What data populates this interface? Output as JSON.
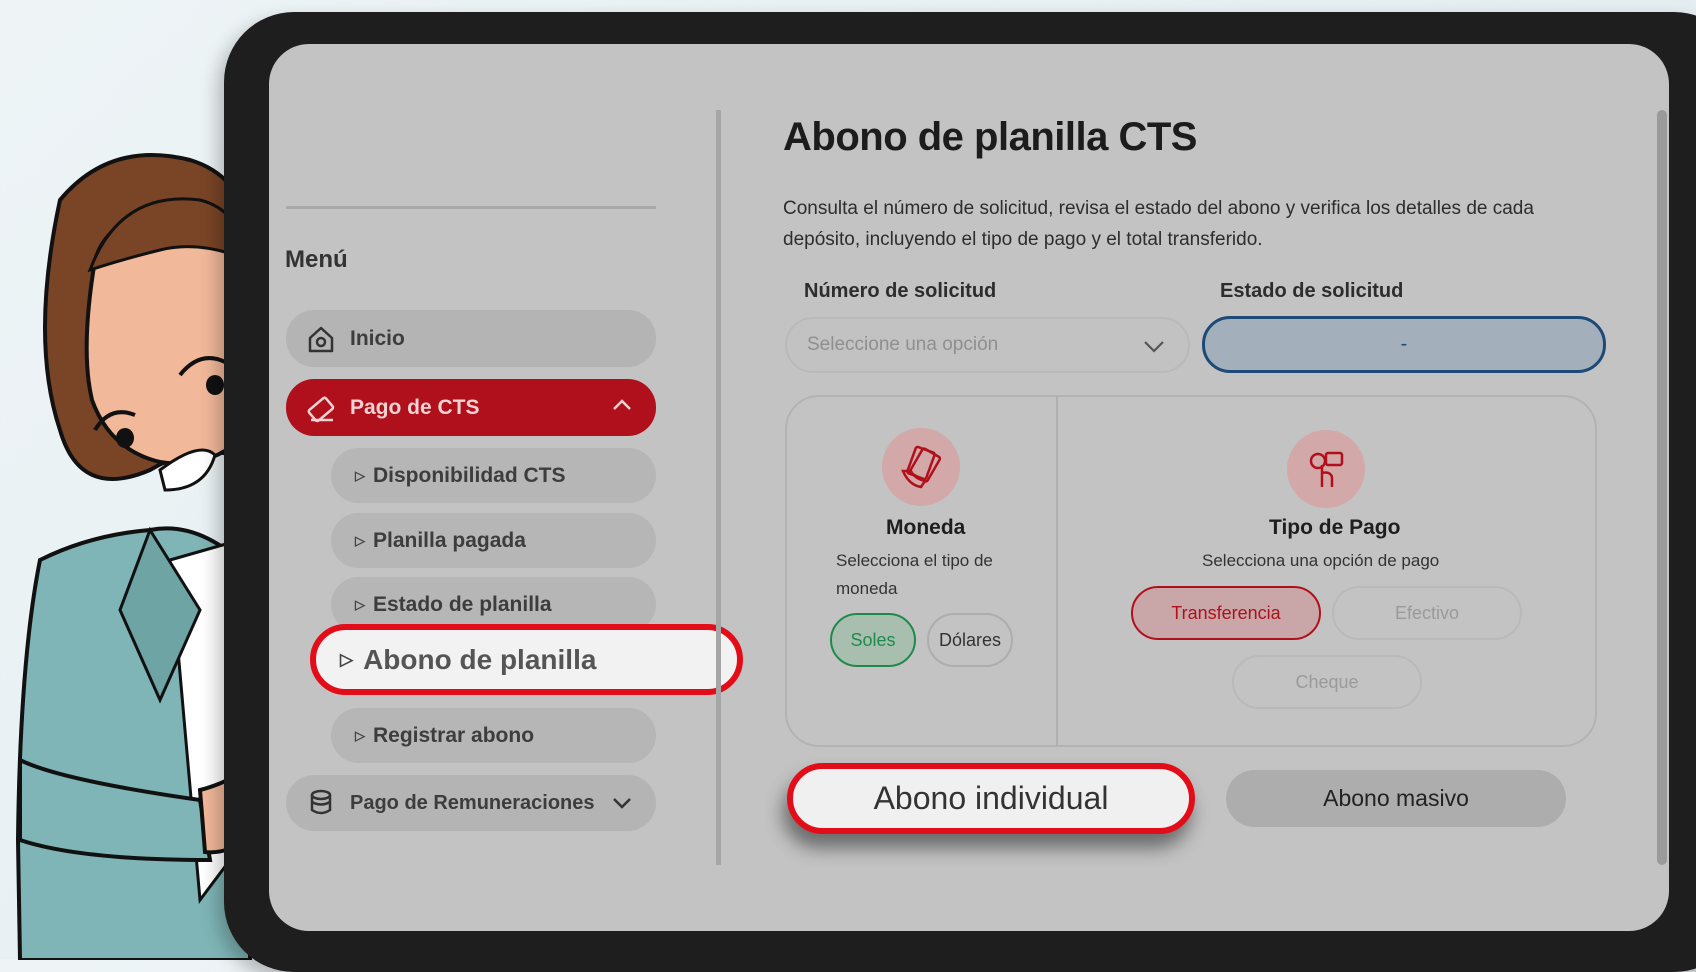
{
  "menu": {
    "title": "Menú",
    "items": [
      {
        "label": "Inicio",
        "icon": "home-icon"
      },
      {
        "label": "Pago de CTS",
        "icon": "cts-icon",
        "active": true
      },
      {
        "label": "Pago de Remuneraciones",
        "icon": "coins-icon"
      }
    ],
    "submenu": [
      {
        "label": "Disponibilidad CTS"
      },
      {
        "label": "Planilla pagada"
      },
      {
        "label": "Estado de planilla"
      },
      {
        "label": "Abono de planilla"
      },
      {
        "label": "Registrar abono"
      }
    ]
  },
  "main": {
    "title": "Abono de planilla CTS",
    "description": "Consulta el número de solicitud, revisa el estado del abono y verifica los detalles de cada depósito, incluyendo el tipo de pago y el total transferido.",
    "numero_label": "Número de solicitud",
    "numero_placeholder": "Seleccione una opción",
    "estado_label": "Estado de solicitud",
    "estado_value": "-",
    "moneda": {
      "title": "Moneda",
      "subtitle": "Selecciona el tipo de moneda",
      "options": [
        "Soles",
        "Dólares"
      ],
      "selected": "Soles"
    },
    "tipo_pago": {
      "title": "Tipo de Pago",
      "subtitle": "Selecciona una opción de pago",
      "options": [
        "Transferencia",
        "Efectivo",
        "Cheque"
      ],
      "selected": "Transferencia"
    },
    "buttons": {
      "individual": "Abono individual",
      "masivo": "Abono masivo"
    }
  },
  "colors": {
    "accent": "#b0101b",
    "highlight": "#e30d1a",
    "selected_green": "#1f8a4c",
    "estado_border": "#1d4a77"
  }
}
